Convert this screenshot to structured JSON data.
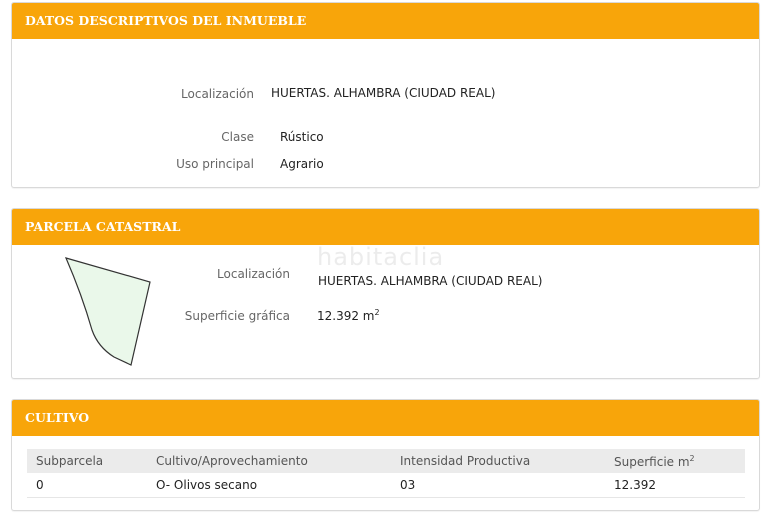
{
  "inmueble": {
    "title": "DATOS DESCRIPTIVOS DEL INMUEBLE",
    "localizacion_label": "Localización",
    "localizacion_value": "HUERTAS. ALHAMBRA (CIUDAD REAL)",
    "clase_label": "Clase",
    "clase_value": "Rústico",
    "uso_label": "Uso principal",
    "uso_value": "Agrario"
  },
  "parcela": {
    "title": "PARCELA CATASTRAL",
    "watermark": "habitaclia",
    "localizacion_label": "Localización",
    "localizacion_value": "HUERTAS. ALHAMBRA (CIUDAD REAL)",
    "superficie_label": "Superficie gráfica",
    "superficie_value": "12.392 m",
    "superficie_unit_sup": "2",
    "shape_fill": "#eaf8ea",
    "shape_stroke": "#333333"
  },
  "cultivo": {
    "title": "CULTIVO",
    "headers": [
      "Subparcela",
      "Cultivo/Aprovechamiento",
      "Intensidad Productiva",
      "Superficie m"
    ],
    "header_sup": "2",
    "rows": [
      [
        "0",
        "O- Olivos secano",
        "03",
        "12.392"
      ]
    ]
  },
  "colors": {
    "header_bg": "#f8a50a",
    "header_text": "#ffffff"
  }
}
